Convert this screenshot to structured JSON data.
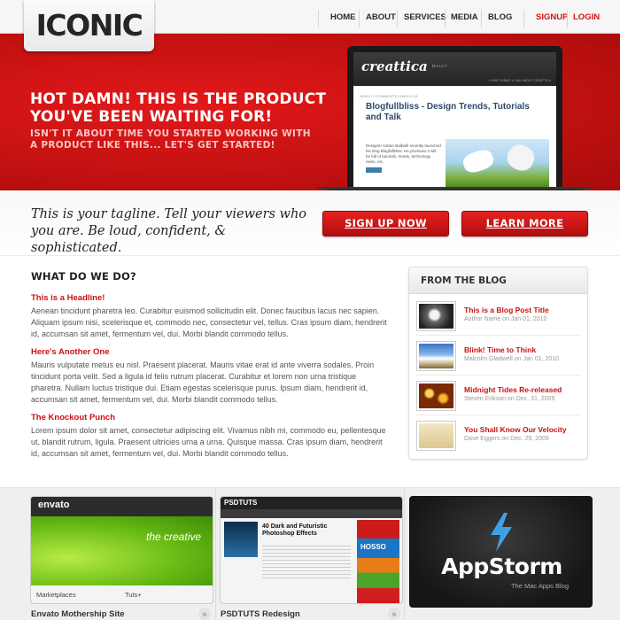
{
  "header": {
    "logo": "ICONIC",
    "nav": [
      "HOME",
      "ABOUT",
      "SERVICES",
      "MEDIA",
      "BLOG"
    ],
    "signup": "SIGNUP",
    "login": "LOGIN"
  },
  "hero": {
    "headline": "HOT DAMN! THIS IS THE PRODUCT YOU'VE BEEN WAITING FOR!",
    "subhead": "ISN'T IT ABOUT TIME YOU STARTED WORKING WITH A PRODUCT LIKE THIS... LET'S GET STARTED!",
    "screen": {
      "brand": "creattica",
      "daily": "DAILY",
      "mini_nav": "HOME  SUBMIT A LINK  ABOUT CREATTICA",
      "meta": "NEWS  |  3 COMMENTS  |  MARCH 18",
      "title": "Blogfullbliss - Design Trends, Tutorials and Talk",
      "body": "Designer Adrian Balkwill recently launched his blog Blogfullbliss. He promises it will be full of tutorials, trends, technology news, etc."
    }
  },
  "cta_row": {
    "tagline": "This is your tagline. Tell your viewers who you are. Be loud, confident, & sophisticated.",
    "signup_button": "SIGN UP NOW",
    "learn_button": "LEARN MORE"
  },
  "main": {
    "title": "WHAT DO WE DO?",
    "blocks": [
      {
        "heading": "This is a Headline!",
        "text": "Aenean tincidunt pharetra leo. Curabitur euismod sollicitudin elit. Donec faucibus lacus nec sapien. Aliquam ipsum nisi, scelerisque et, commodo nec, consectetur vel, tellus. Cras ipsum diam, hendrerit id, accumsan sit amet, fermentum vel, dui. Morbi blandit commodo tellus."
      },
      {
        "heading": "Here's Another One",
        "text": "Mauris vulputate metus eu nisl. Praesent placerat. Mauris vitae erat id ante viverra sodales. Proin tincidunt porta velit. Sed a ligula id felis rutrum placerat. Curabitur et lorem non urna tristique pharetra. Nullam luctus tristique dui. Etiam egestas scelerisque purus. Ipsum diam, hendrerit id, accumsan sit amet, fermentum vel, dui. Morbi blandit commodo tellus."
      },
      {
        "heading": "The Knockout Punch",
        "text": "Lorem ipsum dolor sit amet, consectetur adipiscing elit. Vivamus nibh mi, commodo eu, pellentesque ut, blandit rutrum, ligula. Praesent ultricies urna a urna. Quisque massa. Cras ipsum diam, hendrerit id, accumsan sit amet, fermentum vel, dui. Morbi blandit commodo tellus."
      }
    ]
  },
  "blog": {
    "title": "FROM THE BLOG",
    "posts": [
      {
        "title": "This is a Blog Post Title",
        "meta": "Author Name on Jan 01, 2010"
      },
      {
        "title": "Blink! Time to Think",
        "meta": "Malcolm Gladwell on Jan 01, 2010"
      },
      {
        "title": "Midnight Tides Re-released",
        "meta": "Steven Erikson on Dec. 31, 2009"
      },
      {
        "title": "You Shall Know Our Velocity",
        "meta": "Dave Eggers on Dec. 29, 2009"
      }
    ]
  },
  "portfolio": {
    "items": [
      {
        "caption": "Envato Mothership Site",
        "logo": "envato",
        "tagline": "the creative",
        "col1": "Marketplaces",
        "col2": "Tuts+"
      },
      {
        "caption": "PSDTUTS Redesign",
        "logo": "PSDTUTS",
        "headline": "40 Dark and Futuristic Photoshop Effects",
        "side": "HOSSO"
      },
      {
        "caption": "",
        "logo": "AppStorm",
        "tagline": "The Mac Apps Blog"
      }
    ],
    "arrow": "»"
  }
}
